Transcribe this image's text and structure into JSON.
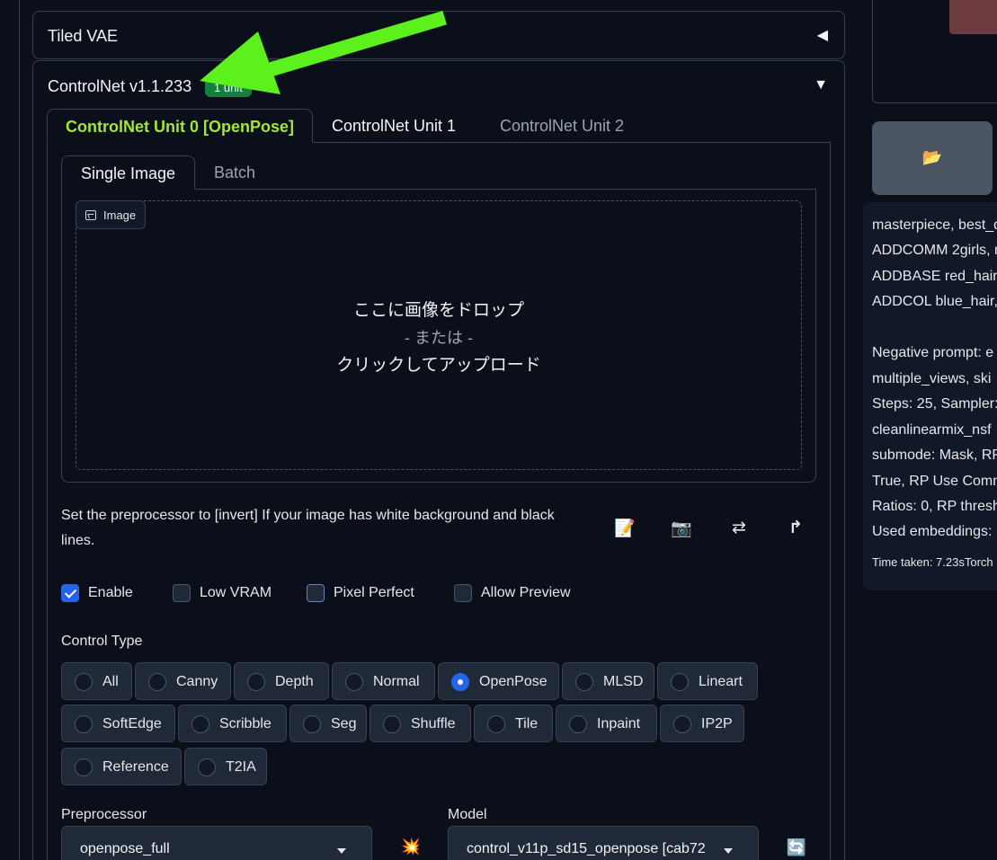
{
  "tiled_vae": {
    "title": "Tiled VAE",
    "toggle": "◀"
  },
  "controlnet": {
    "title": "ControlNet v1.1.233",
    "badge": "1 unit",
    "toggle": "▼",
    "unit_tabs": [
      "ControlNet Unit 0 [OpenPose]",
      "ControlNet Unit 1",
      "ControlNet Unit 2"
    ],
    "image_tabs": [
      "Single Image",
      "Batch"
    ],
    "image_label": "Image",
    "drop_text": {
      "line1": "ここに画像をドロップ",
      "line2": "- または -",
      "line3": "クリックしてアップロード"
    },
    "hint": "Set the preprocessor to [invert] If your image has white background and black lines.",
    "tools": {
      "edit_icon": "📝",
      "camera_icon": "📷",
      "swap_icon": "⇄",
      "send_icon": "↱"
    },
    "checkboxes": [
      {
        "label": "Enable",
        "checked": true
      },
      {
        "label": "Low VRAM",
        "checked": false
      },
      {
        "label": "Pixel Perfect",
        "checked": false
      },
      {
        "label": "Allow Preview",
        "checked": false
      }
    ],
    "control_type_label": "Control Type",
    "control_types": [
      "All",
      "Canny",
      "Depth",
      "Normal",
      "OpenPose",
      "MLSD",
      "Lineart",
      "SoftEdge",
      "Scribble",
      "Seg",
      "Shuffle",
      "Tile",
      "Inpaint",
      "IP2P",
      "Reference",
      "T2IA"
    ],
    "selected_control_type": "OpenPose",
    "preprocessor_label": "Preprocessor",
    "preprocessor_value": "openpose_full",
    "run_icon": "💥",
    "model_label": "Model",
    "model_value": "control_v11p_sd15_openpose [cab72",
    "refresh_icon": "🔄"
  },
  "right": {
    "folder_icon": "📂",
    "info_lines": [
      "masterpiece, best_q",
      "ADDCOMM 2girls, m",
      "ADDBASE red_hair,",
      "ADDCOL blue_hair,",
      "",
      "Negative prompt: e",
      "multiple_views, ski",
      "Steps: 25, Sampler:",
      "cleanlinearmix_nsf",
      "submode: Mask, RP",
      "True, RP Use Comm",
      "Ratios: 0, RP thresh",
      "Used embeddings:"
    ],
    "time_taken": "Time taken: 7.23sTorch"
  },
  "colors": {
    "accent_green": "#a3e635",
    "badge_green": "#15803d",
    "selected_blue": "#2563eb",
    "annotation_arrow": "#5cf01c"
  }
}
